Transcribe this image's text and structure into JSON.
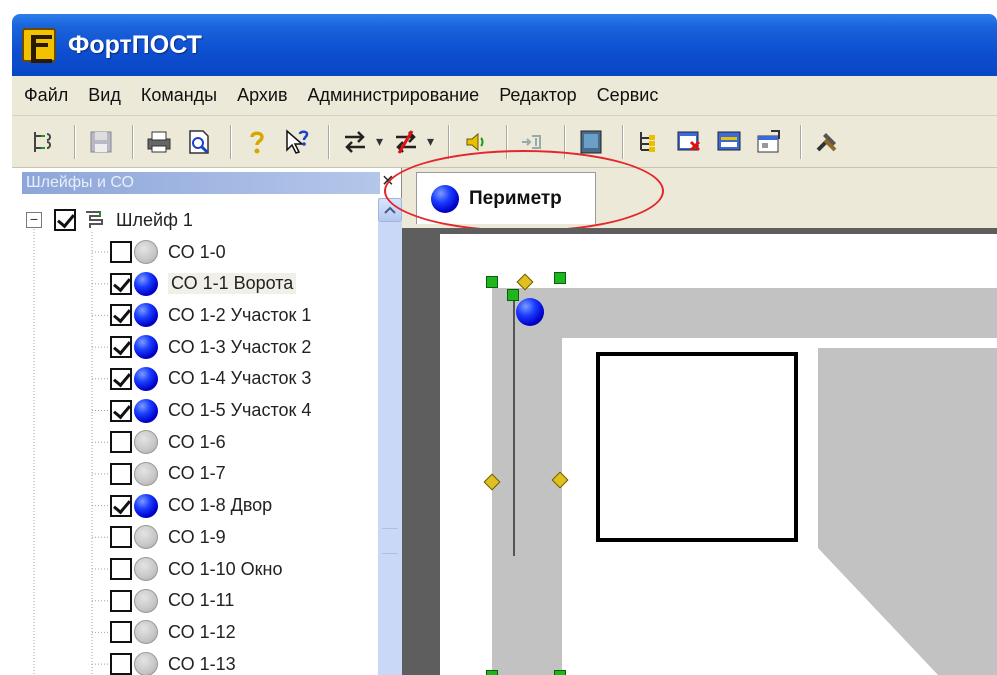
{
  "window": {
    "title": "ФортПОСТ"
  },
  "menu": [
    "Файл",
    "Вид",
    "Команды",
    "Архив",
    "Администрирование",
    "Редактор",
    "Сервис"
  ],
  "panel": {
    "title": "Шлейфы и СО",
    "close_glyph": "×",
    "tree": {
      "root": {
        "label": "Шлейф 1",
        "checked": true,
        "expanded": true,
        "expander_glyph": "−"
      },
      "items": [
        {
          "label": "СО 1-0",
          "checked": false,
          "active": false
        },
        {
          "label": "СО 1-1 Ворота",
          "checked": true,
          "active": true
        },
        {
          "label": "СО 1-2 Участок 1",
          "checked": true,
          "active": true
        },
        {
          "label": "СО 1-3 Участок 2",
          "checked": true,
          "active": true
        },
        {
          "label": "СО 1-4 Участок 3",
          "checked": true,
          "active": true
        },
        {
          "label": "СО 1-5 Участок 4",
          "checked": true,
          "active": true
        },
        {
          "label": "СО 1-6",
          "checked": false,
          "active": false
        },
        {
          "label": "СО 1-7",
          "checked": false,
          "active": false
        },
        {
          "label": "СО 1-8 Двор",
          "checked": true,
          "active": true
        },
        {
          "label": "СО 1-9",
          "checked": false,
          "active": false
        },
        {
          "label": "СО 1-10 Окно",
          "checked": false,
          "active": false
        },
        {
          "label": "СО 1-11",
          "checked": false,
          "active": false
        },
        {
          "label": "СО 1-12",
          "checked": false,
          "active": false
        },
        {
          "label": "СО 1-13",
          "checked": false,
          "active": false
        }
      ]
    }
  },
  "tabs": [
    {
      "label": "Периметр",
      "active": true
    }
  ],
  "colors": {
    "titlebar": "#0d4fd0",
    "active_sensor": "#1a3cff",
    "inactive_sensor": "#c6c6c6",
    "highlight": "#e4262b",
    "handle": "#1eb51e"
  },
  "toolbar_icons": [
    "tree-link-icon",
    "save-icon",
    "print-icon",
    "print-preview-icon",
    "help-icon",
    "context-help-icon",
    "arm-icon",
    "disarm-icon",
    "alarm-sound-icon",
    "input-icon",
    "monitor-icon",
    "tree-view-icon",
    "event-log-icon",
    "screen-icon",
    "properties-icon",
    "tools-icon"
  ]
}
